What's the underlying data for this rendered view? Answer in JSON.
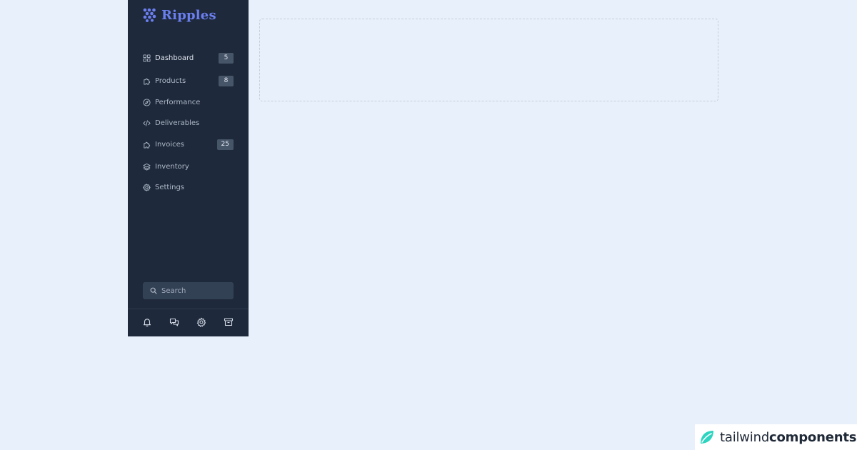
{
  "brand": {
    "name": "Ripples",
    "color": "#6b7ff0"
  },
  "nav": {
    "items": [
      {
        "label": "Dashboard",
        "icon": "grid-icon",
        "badge": "5",
        "active": true
      },
      {
        "label": "Products",
        "icon": "puzzle-icon",
        "badge": "8"
      },
      {
        "label": "Performance",
        "icon": "compass-icon"
      },
      {
        "label": "Deliverables",
        "icon": "code-icon"
      },
      {
        "label": "Invoices",
        "icon": "puzzle-icon",
        "badge": "25"
      },
      {
        "label": "Inventory",
        "icon": "layers-icon"
      },
      {
        "label": "Settings",
        "icon": "gear-icon"
      }
    ]
  },
  "search": {
    "placeholder": "Search"
  },
  "footer": {
    "icons": [
      "bell-icon",
      "chat-icon",
      "gear-icon",
      "archive-icon"
    ]
  },
  "watermark": {
    "text_light": "tailwind",
    "text_bold": "components",
    "accent": "#2dd4bf"
  },
  "colors": {
    "sidebar_bg": "#1e293b",
    "page_bg": "#e8f0fb",
    "badge_bg": "#475569"
  }
}
